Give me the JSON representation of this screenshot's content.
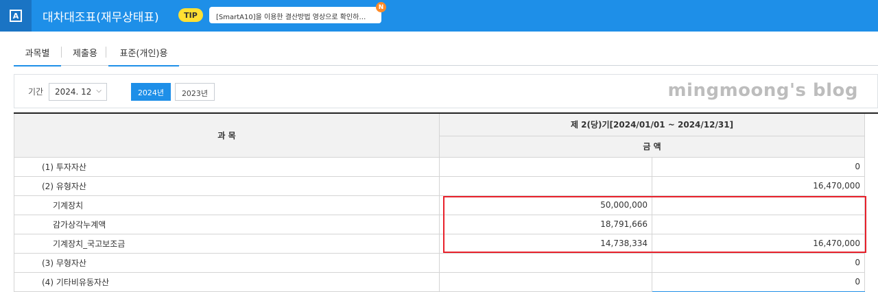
{
  "header": {
    "app_icon": "A",
    "title": "대차대조표(재무상태표)",
    "tip_label": "TIP",
    "tip_text": "[SmartA10]을 이용한 결산방법 영상으로 확인하…",
    "new_badge": "N"
  },
  "tabs": [
    {
      "label": "과목별"
    },
    {
      "label": "제출용"
    },
    {
      "label": "표준(개인)용"
    }
  ],
  "filter": {
    "period_label": "기간",
    "period_value": "2024. 12",
    "years": [
      {
        "label": "2024년"
      },
      {
        "label": "2023년"
      }
    ],
    "watermark": "mingmoong's blog"
  },
  "table": {
    "col_subject": "과 목",
    "col_period": "제 2(당)기[2024/01/01 ~ 2024/12/31]",
    "col_amount": "금 액",
    "rows": [
      {
        "name": "(1)  투자자산",
        "a": "",
        "b": "0"
      },
      {
        "name": "(2)  유형자산",
        "a": "",
        "b": "16,470,000"
      },
      {
        "name": "기계장치",
        "a": "50,000,000",
        "b": ""
      },
      {
        "name": "감가상각누계액",
        "a": "18,791,666",
        "b": ""
      },
      {
        "name": "기계장치_국고보조금",
        "a": "14,738,334",
        "b": "16,470,000"
      },
      {
        "name": "(3)  무형자산",
        "a": "",
        "b": "0"
      },
      {
        "name": "(4)  기타비유동자산",
        "a": "",
        "b": "0"
      }
    ]
  },
  "colors": {
    "accent": "#1e8fe8",
    "highlight": "#e8202a",
    "tip": "#ffe033"
  }
}
